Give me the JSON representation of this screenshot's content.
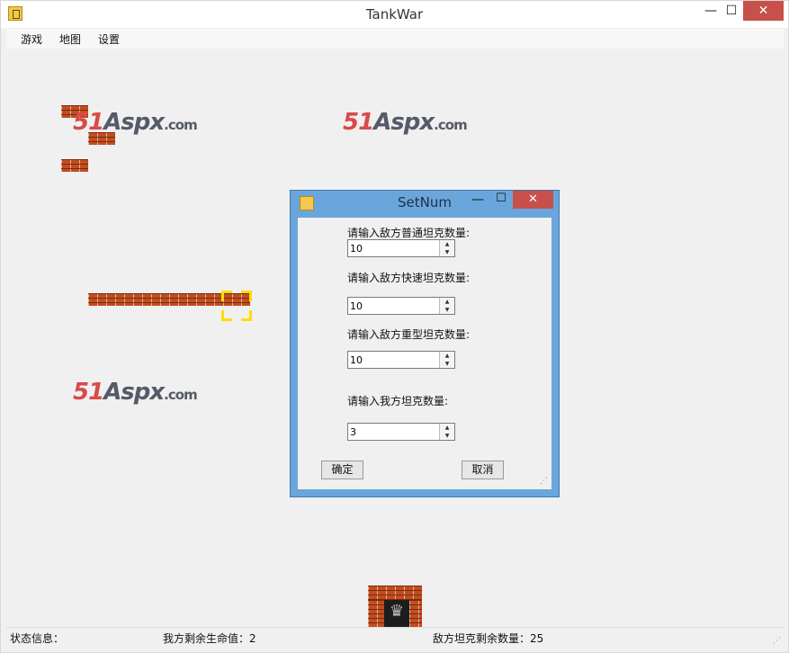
{
  "window": {
    "title": "TankWar",
    "min": "—",
    "max": "☐",
    "close": "✕"
  },
  "menu": {
    "items": [
      "游戏",
      "地图",
      "设置"
    ]
  },
  "watermark": {
    "part1": "51",
    "part2": "Aspx",
    "part3": ".com"
  },
  "status": {
    "info": "状态信息：",
    "lives": "我方剩余生命值：2",
    "enemies": "敌方坦克剩余数量：25"
  },
  "dialog": {
    "title": "SetNum",
    "min": "—",
    "max": "☐",
    "close": "✕",
    "fields": [
      {
        "label": "请输入敌方普通坦克数量:",
        "value": "10"
      },
      {
        "label": "请输入敌方快速坦克数量:",
        "value": "10"
      },
      {
        "label": "请输入敌方重型坦克数量:",
        "value": "10"
      },
      {
        "label": "请输入我方坦克数量:",
        "value": "3"
      }
    ],
    "ok": "确定",
    "cancel": "取消"
  },
  "icons": {
    "app": "tank-app-icon",
    "up": "▲",
    "down": "▼",
    "grip": "⋰",
    "eagle": "♛"
  },
  "colors": {
    "brick": "#c24e1f",
    "spawn": "#ffdd00",
    "dialog_frame": "#6aa6dc",
    "close": "#c7504a"
  }
}
